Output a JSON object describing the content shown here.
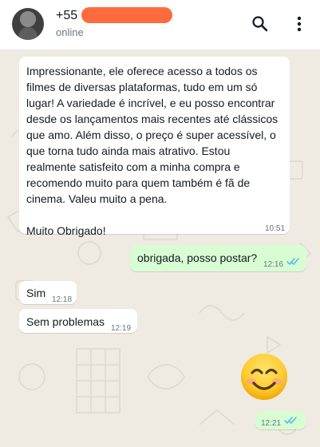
{
  "header": {
    "contact_name": "+55",
    "status": "online"
  },
  "messages": [
    {
      "direction": "incoming",
      "text": "Impressionante, ele oferece acesso a todos os\nfilmes de diversas plataformas, tudo em um só\nlugar! A variedade é incrível, e eu posso encontrar\ndesde os lançamentos mais recentes até clássicos\nque amo. Além disso, o preço é super acessível, o\nque torna tudo ainda mais atrativo. Estou\nrealmente satisfeito com a minha compra e\nrecomendo muito para quem também é fã de\ncinema. Valeu muito a pena.\n\nMuito Obrigado!",
      "time": "10:51"
    },
    {
      "direction": "outgoing",
      "text": "obrigada, posso postar?",
      "time": "12:16"
    },
    {
      "direction": "incoming",
      "text": "Sim",
      "time": "12:18"
    },
    {
      "direction": "incoming",
      "text": "Sem problemas",
      "time": "12:19"
    },
    {
      "direction": "outgoing",
      "emoji": "smiling-face-emoji",
      "time": "12:21"
    }
  ],
  "colors": {
    "chat_background": "#efeae2",
    "incoming_bubble": "#ffffff",
    "outgoing_bubble": "#d9fdd3",
    "read_receipt": "#53bdeb"
  },
  "icons": [
    "search-icon",
    "more-vertical-icon",
    "double-check-icon"
  ]
}
